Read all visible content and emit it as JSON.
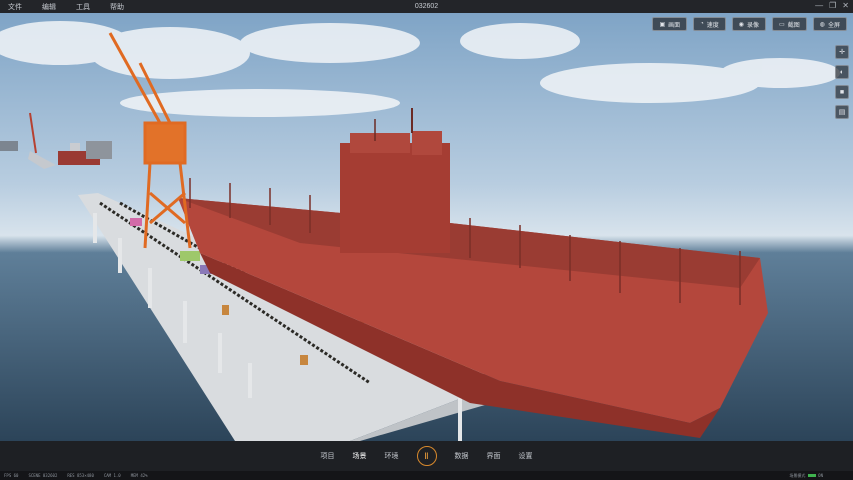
{
  "window": {
    "title": "032602",
    "menu": [
      "文件",
      "编辑",
      "工具",
      "帮助"
    ],
    "controls": [
      "—",
      "❐",
      "✕"
    ]
  },
  "viewport": {
    "top_buttons": [
      {
        "icon": "image-icon",
        "label": "画面"
      },
      {
        "icon": "gauge-icon",
        "label": "速度"
      },
      {
        "icon": "camera-icon",
        "label": "录像"
      },
      {
        "icon": "screen-icon",
        "label": "截图"
      },
      {
        "icon": "globe-icon",
        "label": "全屏"
      }
    ],
    "side_buttons": [
      "move-icon",
      "orbit-icon",
      "stop-icon",
      "layers-icon"
    ]
  },
  "bottom_tabs": {
    "left": [
      "项目",
      "场景",
      "环境"
    ],
    "right": [
      "数据",
      "界面",
      "设置"
    ],
    "active": "场景",
    "logo_glyph": "Ⅱ"
  },
  "status": {
    "items": [
      "FPS 60",
      "SCENE 032602",
      "RES 853×480",
      "CAM 1.0",
      "MEM 42%"
    ],
    "right_label": "场景模式",
    "right_value": "ON"
  },
  "colors": {
    "hull": "#b4473c",
    "crane": "#e06a22",
    "accent": "#d8892c"
  }
}
